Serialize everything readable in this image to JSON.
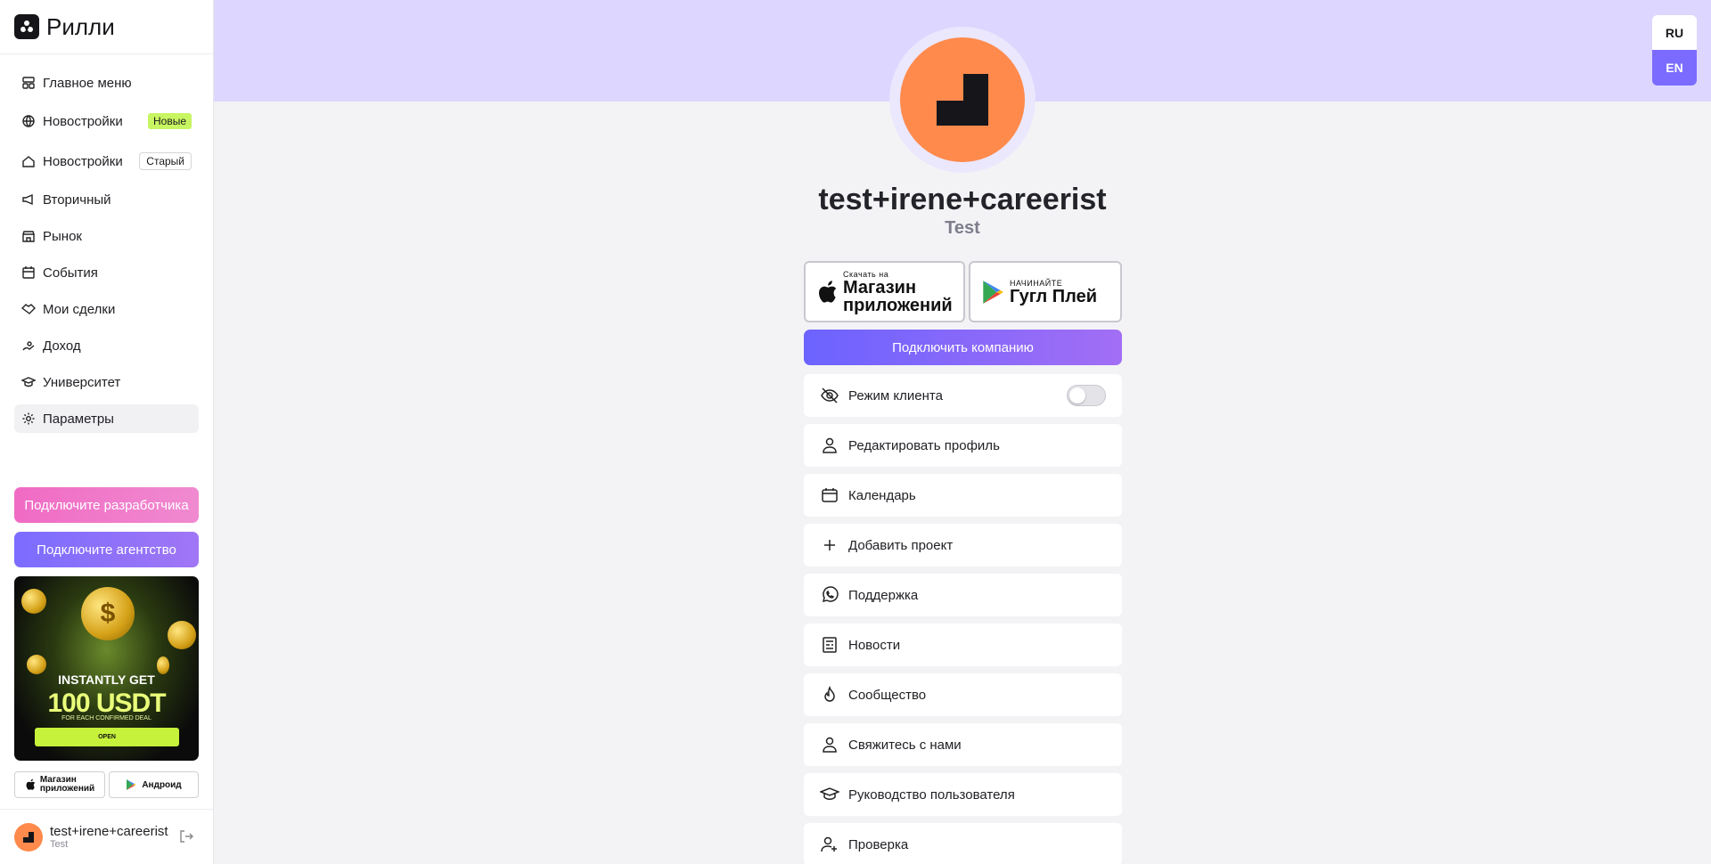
{
  "brand": {
    "name": "Рилли"
  },
  "sidebar": {
    "items": [
      {
        "label": "Главное меню",
        "icon": "dashboard-icon"
      },
      {
        "label": "Новостройки",
        "icon": "globe-icon",
        "badge": "Новые"
      },
      {
        "label": "Новостройки",
        "icon": "home-icon",
        "badge": "Старый"
      },
      {
        "label": "Вторичный",
        "icon": "megaphone-icon"
      },
      {
        "label": "Рынок",
        "icon": "store-icon"
      },
      {
        "label": "События",
        "icon": "calendar-icon"
      },
      {
        "label": "Мои сделки",
        "icon": "handshake-icon"
      },
      {
        "label": "Доход",
        "icon": "income-icon"
      },
      {
        "label": "Университет",
        "icon": "graduation-cap-icon"
      },
      {
        "label": "Параметры",
        "icon": "gear-icon",
        "active": true
      }
    ],
    "cta_developer": "Подключите разработчика",
    "cta_agency": "Подключите агентство",
    "promo": {
      "title": "INSTANTLY GET",
      "amount": "100 USDT",
      "subtitle": "FOR EACH CONFIRMED DEAL",
      "button": "OPEN"
    },
    "store_apple": {
      "line1": "Магазин",
      "line2": "приложений"
    },
    "store_android": "Андроид",
    "user": {
      "name": "test+irene+careerist",
      "role": "Test"
    }
  },
  "lang": {
    "ru": "RU",
    "en": "EN",
    "selected": "EN"
  },
  "profile": {
    "name": "test+irene+careerist",
    "role": "Test"
  },
  "stores": {
    "apple": {
      "small": "Скачать на",
      "big1": "Магазин",
      "big2": "приложений"
    },
    "google": {
      "small": "НАЧИНАЙТЕ",
      "big": "Гугл Плей"
    }
  },
  "connect_company": "Подключить компанию",
  "menu": {
    "client_mode": {
      "label": "Режим клиента",
      "enabled": false
    },
    "items": [
      {
        "label": "Редактировать профиль",
        "icon": "user-icon"
      },
      {
        "label": "Календарь",
        "icon": "calendar-icon"
      },
      {
        "label": "Добавить проект",
        "icon": "plus-icon"
      },
      {
        "label": "Поддержка",
        "icon": "whatsapp-icon"
      },
      {
        "label": "Новости",
        "icon": "news-icon"
      },
      {
        "label": "Сообщество",
        "icon": "flame-icon"
      },
      {
        "label": "Свяжитесь с нами",
        "icon": "user-icon"
      },
      {
        "label": "Руководство пользователя",
        "icon": "graduation-cap-icon"
      },
      {
        "label": "Проверка",
        "icon": "user-plus-icon"
      }
    ]
  },
  "colors": {
    "accent": "#7b6cff",
    "avatar": "#ff8a4c",
    "hero": "#ddd6ff",
    "badge_new": "#c8f562"
  }
}
